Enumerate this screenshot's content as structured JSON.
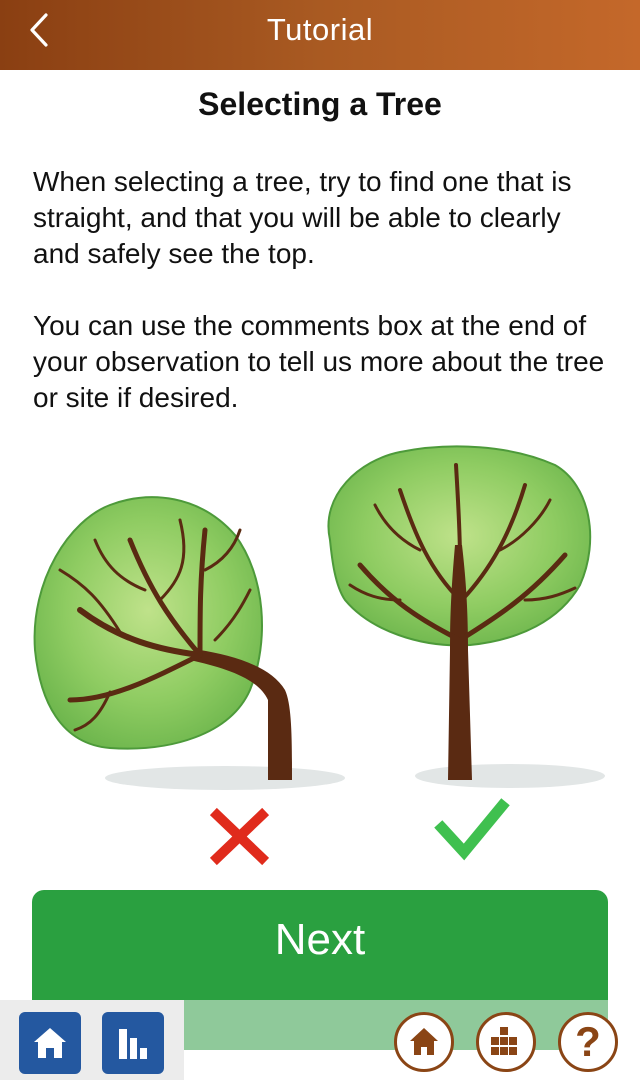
{
  "appbar": {
    "title": "Tutorial",
    "back_icon": "chevron-left-icon"
  },
  "page": {
    "title": "Selecting a Tree",
    "paragraphs": [
      "When selecting a tree, try to find one that is straight, and that you will be able to clearly and safely see the top.",
      "You can use the comments box at the end of your observation to tell us more about the tree or site if desired."
    ]
  },
  "illustration": {
    "bad_tree": "leaning-tree",
    "good_tree": "straight-tree",
    "bad_mark": "red-x-icon",
    "good_mark": "green-checkmark-icon"
  },
  "next_button": {
    "label": "Next"
  },
  "bottom_bar": {
    "icons": [
      "home-icon",
      "bar-chart-icon",
      "home-icon",
      "grid-icon",
      "help-icon"
    ],
    "help_label": "?"
  },
  "colors": {
    "appbar_start": "#8a3f12",
    "appbar_end": "#c4682a",
    "next_button": "#2aa040",
    "square_button": "#2458a0",
    "circle_button_border": "#8a4515",
    "red_mark": "#e02b1c",
    "green_mark": "#3fc04f"
  }
}
